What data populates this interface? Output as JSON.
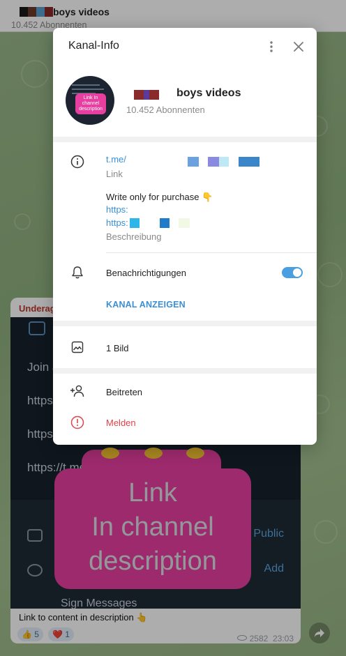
{
  "chat": {
    "title": "boys videos",
    "subtitle": "10.452 Abonnenten",
    "message": {
      "sender": "Underag",
      "image_rows": [
        "Join a",
        "https:/",
        "https:/",
        "https://t.me/"
      ],
      "image_band_rows": [
        "",
        "",
        "Sign Messages"
      ],
      "image_band_accents": [
        "Public",
        "Add"
      ],
      "sticker_lines": [
        "Link",
        "In channel",
        "description"
      ],
      "caption": "Link to content in description 👆",
      "reactions": [
        {
          "emoji": "👍",
          "count": "5"
        },
        {
          "emoji": "❤️",
          "count": "1"
        }
      ],
      "views": "2582",
      "time": "23:03"
    }
  },
  "modal": {
    "title": "Kanal-Info",
    "channel_name": "boys videos",
    "subscribers": "10.452 Abonnenten",
    "avatar_label": "Link In channel description",
    "info": {
      "link": "t.me/",
      "link_caption": "Link",
      "description_line1": "Write only for purchase 👇",
      "description_link1": "https:",
      "description_link2": "https:",
      "description_caption": "Beschreibung"
    },
    "notifications_label": "Benachrichtigungen",
    "notifications_on": true,
    "view_channel_label": "KANAL ANZEIGEN",
    "media_label": "1 Bild",
    "join_label": "Beitreten",
    "report_label": "Melden"
  },
  "colors": {
    "accent": "#3a8fd6",
    "danger": "#e0424a",
    "sticker": "#e63fa0",
    "toggle_on": "#4a9fe0"
  }
}
